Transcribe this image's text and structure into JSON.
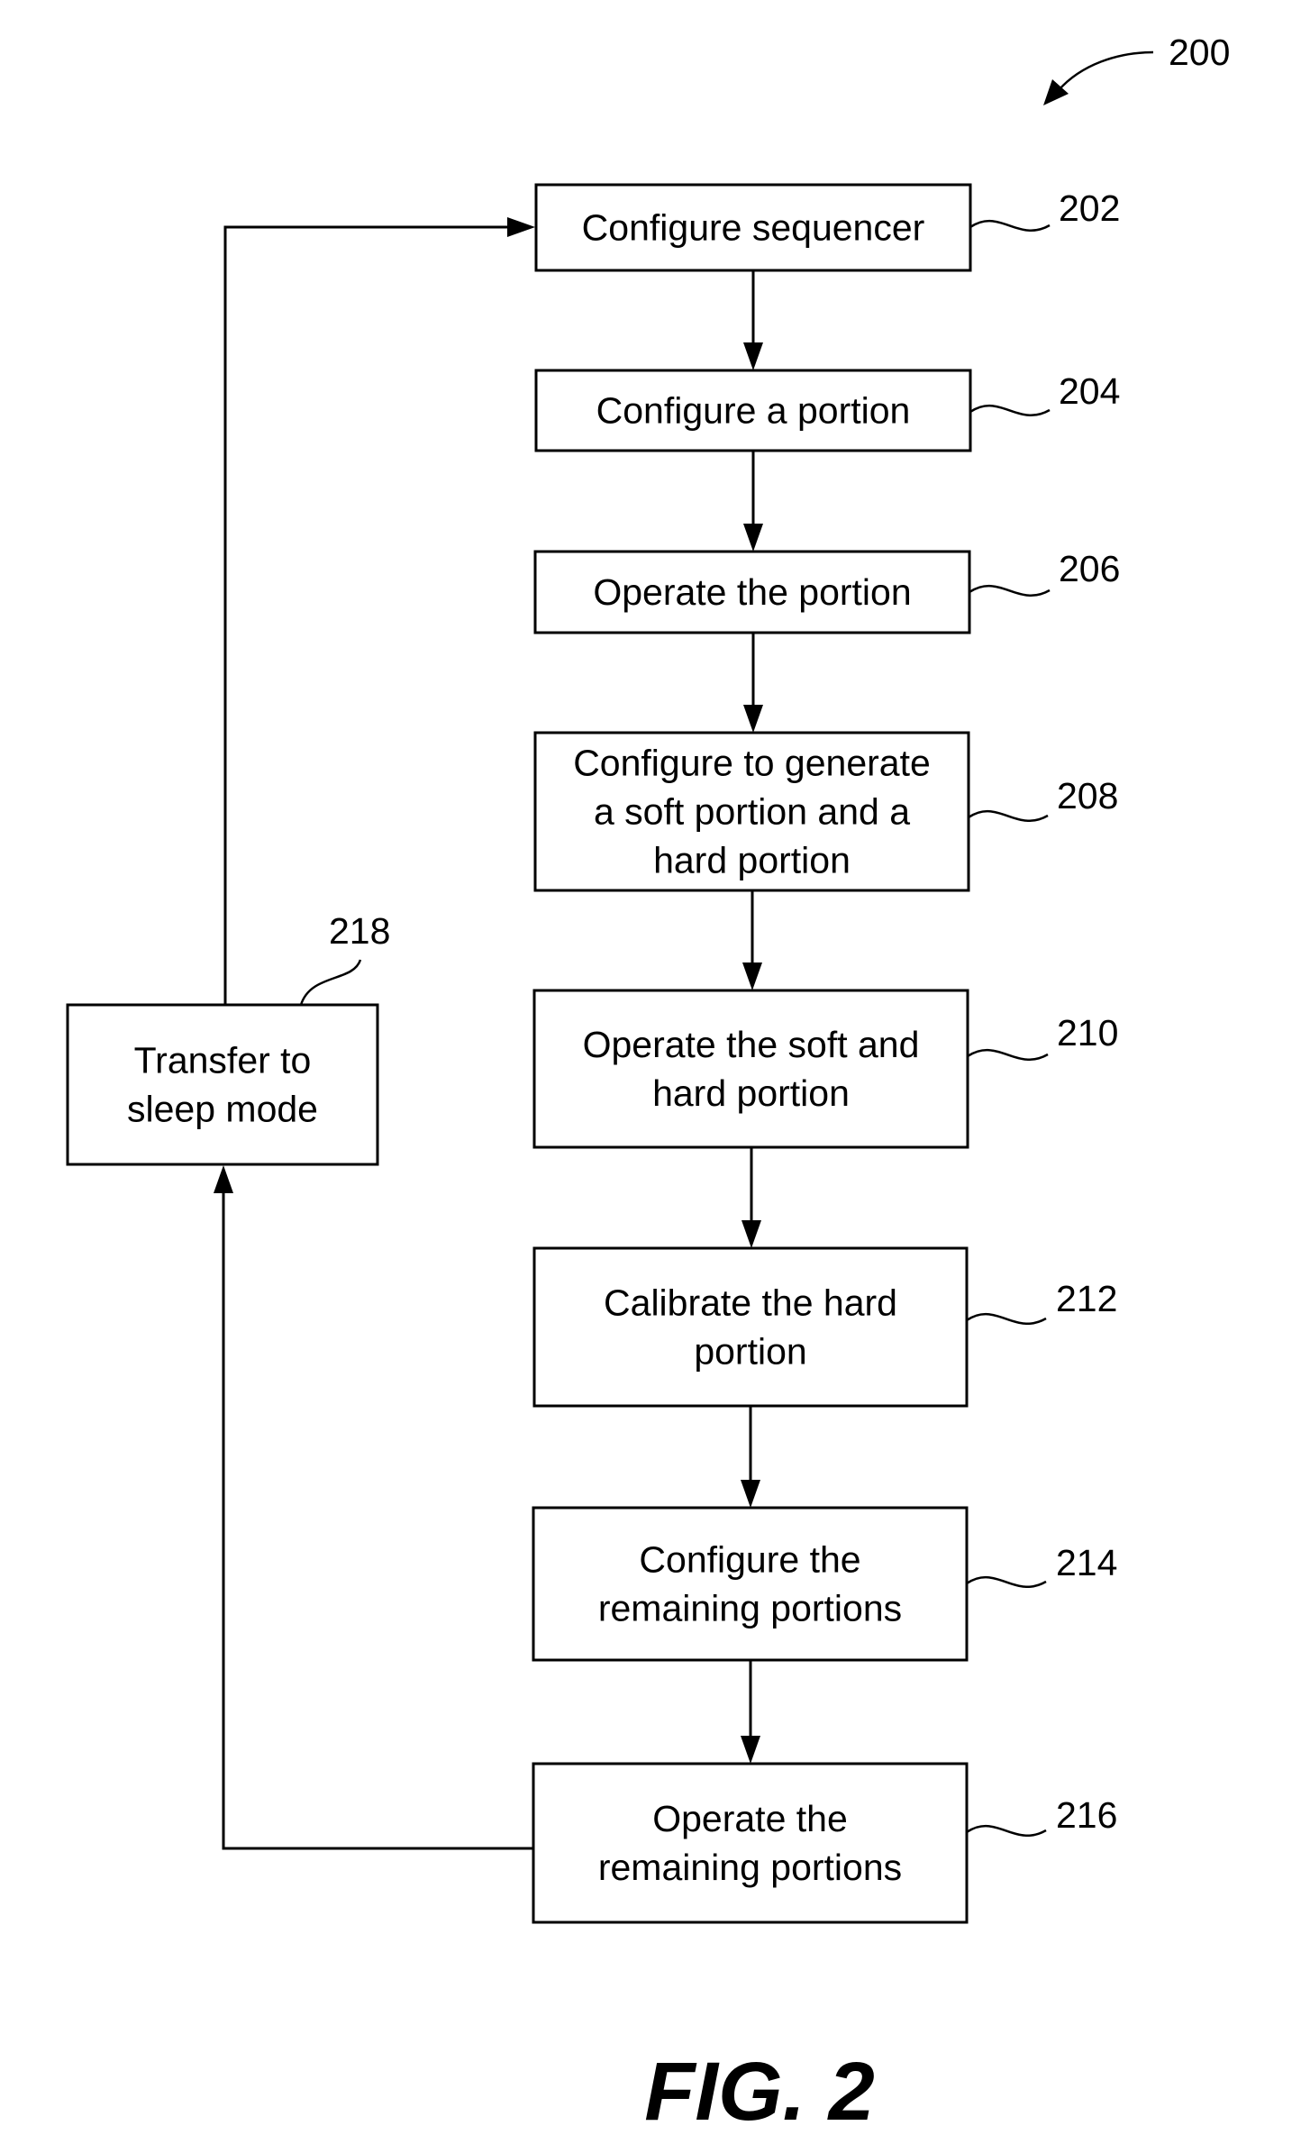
{
  "figure": {
    "reference": "200",
    "caption": "FIG. 2"
  },
  "steps": [
    {
      "id": "202",
      "lines": [
        "Configure sequencer"
      ]
    },
    {
      "id": "204",
      "lines": [
        "Configure a portion"
      ]
    },
    {
      "id": "206",
      "lines": [
        "Operate the portion"
      ]
    },
    {
      "id": "208",
      "lines": [
        "Configure to generate",
        "a soft portion and a",
        "hard portion"
      ]
    },
    {
      "id": "210",
      "lines": [
        "Operate the soft and",
        "hard portion"
      ]
    },
    {
      "id": "212",
      "lines": [
        "Calibrate the hard",
        "portion"
      ]
    },
    {
      "id": "214",
      "lines": [
        "Configure the",
        "remaining portions"
      ]
    },
    {
      "id": "216",
      "lines": [
        "Operate the",
        "remaining portions"
      ]
    },
    {
      "id": "218",
      "lines": [
        "Transfer to",
        "sleep mode"
      ]
    }
  ],
  "flow": [
    [
      "202",
      "204"
    ],
    [
      "204",
      "206"
    ],
    [
      "206",
      "208"
    ],
    [
      "208",
      "210"
    ],
    [
      "210",
      "212"
    ],
    [
      "212",
      "214"
    ],
    [
      "214",
      "216"
    ],
    [
      "216",
      "218"
    ],
    [
      "218",
      "202"
    ]
  ]
}
